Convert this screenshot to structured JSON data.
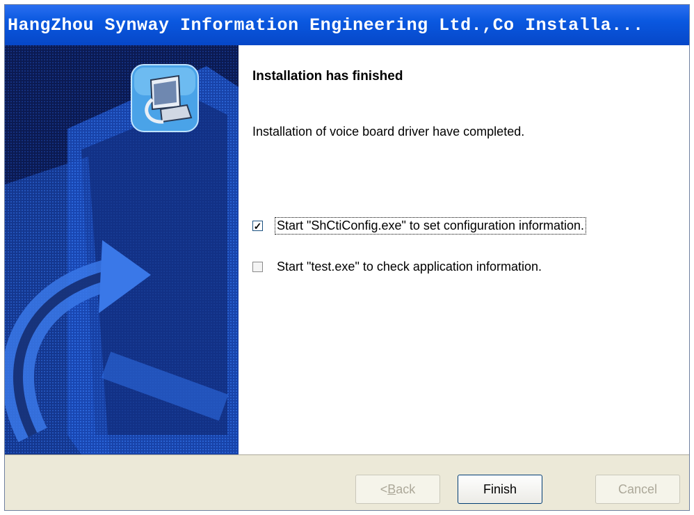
{
  "window": {
    "title": "HangZhou Synway Information Engineering Ltd.,Co   Installa..."
  },
  "content": {
    "heading": "Installation has finished",
    "message": "Installation of voice board driver have completed.",
    "options": [
      {
        "label": "Start \"ShCtiConfig.exe\" to set configuration information.",
        "checked": true
      },
      {
        "label": "Start \"test.exe\" to check application information.",
        "checked": false
      }
    ]
  },
  "buttons": {
    "back_prefix": "< ",
    "back_access": "B",
    "back_rest": "ack",
    "finish": "Finish",
    "cancel": "Cancel"
  },
  "icons": {
    "side": "installer-computer-icon",
    "check": "check-mark-icon"
  },
  "colors": {
    "titlebar": "#0a58e0",
    "side_panel_bg": "#08123a",
    "side_panel_shape": "#1f55c8",
    "dialog_bg": "#ece9d8"
  }
}
